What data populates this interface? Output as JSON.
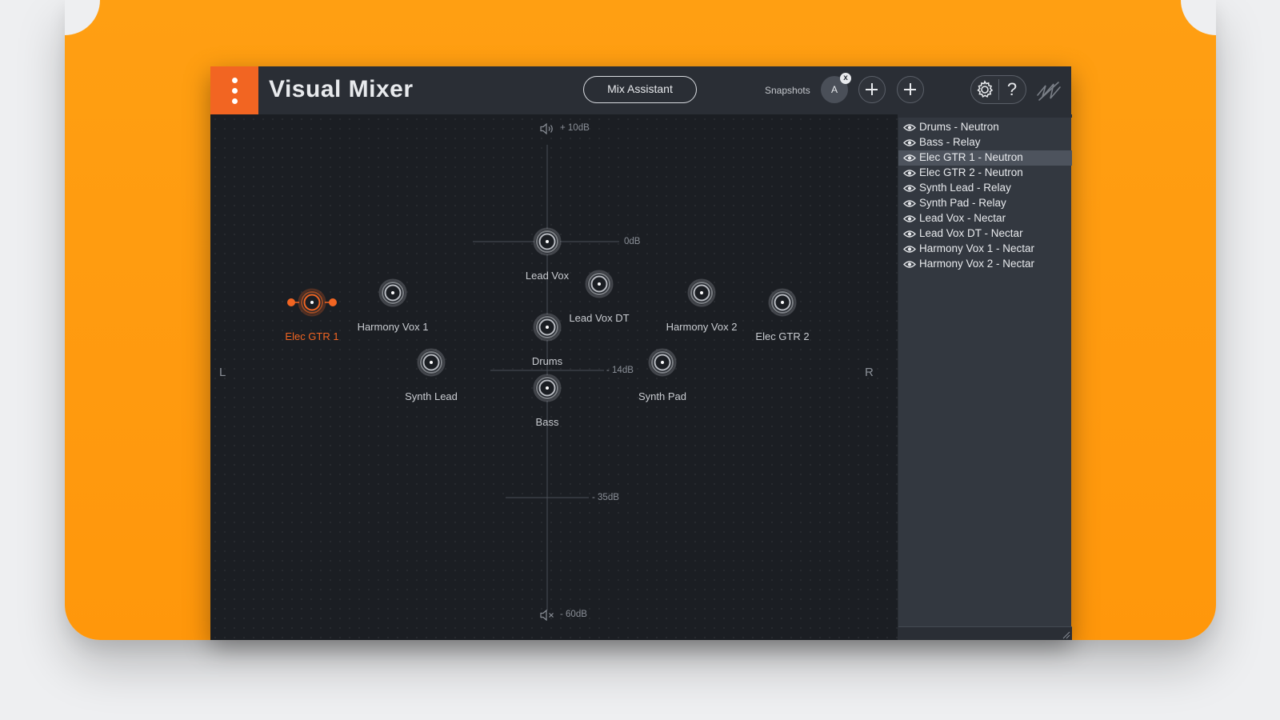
{
  "header": {
    "title": "Visual Mixer",
    "mix_assistant_label": "Mix Assistant",
    "snapshots_label": "Snapshots",
    "snapshot_a": "A",
    "snapshot_remove": "x",
    "help_label": "?"
  },
  "axis": {
    "top_label": "+ 10dB",
    "mark_0": "0dB",
    "mark_14": "- 14dB",
    "mark_35": "- 35dB",
    "bottom_label": "- 60dB",
    "left_label": "L",
    "right_label": "R"
  },
  "nodes": [
    {
      "label": "Lead Vox",
      "selected": false
    },
    {
      "label": "Lead Vox DT",
      "selected": false
    },
    {
      "label": "Harmony Vox 1",
      "selected": false
    },
    {
      "label": "Harmony Vox 2",
      "selected": false
    },
    {
      "label": "Elec GTR 1",
      "selected": true
    },
    {
      "label": "Elec GTR 2",
      "selected": false
    },
    {
      "label": "Drums",
      "selected": false
    },
    {
      "label": "Synth Lead",
      "selected": false
    },
    {
      "label": "Synth Pad",
      "selected": false
    },
    {
      "label": "Bass",
      "selected": false
    }
  ],
  "tracks": [
    {
      "label": "Drums - Neutron",
      "selected": false
    },
    {
      "label": "Bass - Relay",
      "selected": false
    },
    {
      "label": "Elec GTR 1 - Neutron",
      "selected": true
    },
    {
      "label": "Elec GTR 2 - Neutron",
      "selected": false
    },
    {
      "label": "Synth Lead - Relay",
      "selected": false
    },
    {
      "label": "Synth Pad - Relay",
      "selected": false
    },
    {
      "label": "Lead Vox - Nectar",
      "selected": false
    },
    {
      "label": "Lead Vox DT - Nectar",
      "selected": false
    },
    {
      "label": "Harmony Vox 1 - Nectar",
      "selected": false
    },
    {
      "label": "Harmony Vox 2 - Nectar",
      "selected": false
    }
  ],
  "colors": {
    "accent": "#f26522",
    "background": "#ff9a0f"
  },
  "icons": {
    "menu": "menu-dots-icon",
    "gear": "gear-icon",
    "help": "help-icon",
    "logo": "izotope-logo-icon",
    "speaker": "speaker-icon",
    "mute": "mute-icon",
    "eye": "eye-icon"
  }
}
